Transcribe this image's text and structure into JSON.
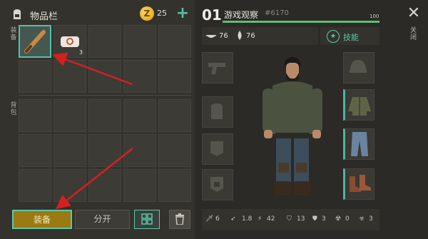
{
  "inventory": {
    "title": "物品栏",
    "coins": "25",
    "coin_symbol": "Z",
    "add_label": "+",
    "equipped_label": [
      "装",
      "备"
    ],
    "backpack_label": [
      "背",
      "包"
    ],
    "item_count_bat": "",
    "item_count_bandage": "3"
  },
  "actions": {
    "equip": "装备",
    "split": "分开",
    "sort_icon": "grid-sort-icon",
    "trash_icon": "trash-icon"
  },
  "character": {
    "level": "01",
    "name": "游戏观察",
    "id": "#6170",
    "xp_value": "100",
    "xp_progress": 1.0,
    "food": "76",
    "water": "76",
    "skills_label": "技能",
    "close_label": [
      "关",
      "闭"
    ]
  },
  "stats": {
    "attack": "6",
    "speed": "1.8",
    "stamina": "42",
    "defense": "13",
    "armor": "3",
    "radiation": "0",
    "bio": "3"
  },
  "colors": {
    "accent": "#5ec8a8",
    "equip_button": "#9a7a12",
    "xp": "#5dbf72",
    "annotation_arrow": "#d42020"
  }
}
